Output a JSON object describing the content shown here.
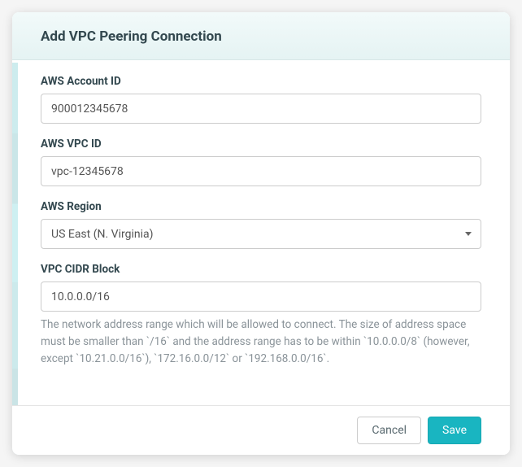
{
  "modal": {
    "title": "Add VPC Peering Connection"
  },
  "fields": {
    "account_id": {
      "label": "AWS Account ID",
      "value": "900012345678"
    },
    "vpc_id": {
      "label": "AWS VPC ID",
      "value": "vpc-12345678"
    },
    "region": {
      "label": "AWS Region",
      "selected": "US East (N. Virginia)"
    },
    "cidr": {
      "label": "VPC CIDR Block",
      "value": "10.0.0.0/16",
      "help": "The network address range which will be allowed to connect. The size of address space must be smaller than `/16` and the address range has to be within `10.0.0.0/8` (however, except `10.21.0.0/16`), `172.16.0.0/12` or `192.168.0.0/16`."
    }
  },
  "buttons": {
    "cancel": "Cancel",
    "save": "Save"
  }
}
